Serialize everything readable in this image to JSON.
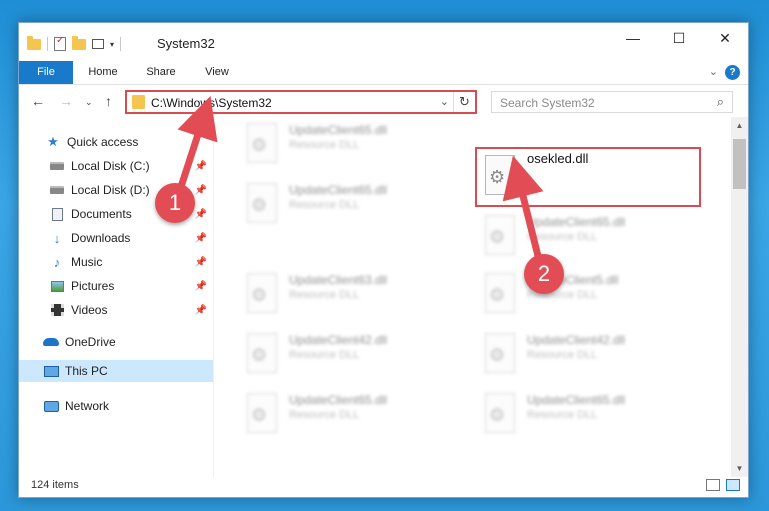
{
  "window": {
    "title": "System32",
    "controls": {
      "minimize": "—",
      "maximize": "☐",
      "close": "✕"
    }
  },
  "ribbon": {
    "tabs": [
      "File",
      "Home",
      "Share",
      "View"
    ],
    "expand": "⌄",
    "help": "?"
  },
  "navigation": {
    "back": "←",
    "forward": "→",
    "recent": "⌄",
    "up": "↑",
    "address": "C:\\Windows\\System32",
    "address_dropdown": "⌄",
    "refresh": "↻",
    "search_placeholder": "Search System32",
    "search_icon": "⌕"
  },
  "sidebar": {
    "items": [
      {
        "label": "Quick access",
        "icon": "star-icon"
      },
      {
        "label": "Local Disk (C:)",
        "icon": "drive-icon",
        "pinned": true
      },
      {
        "label": "Local Disk (D:)",
        "icon": "drive-icon",
        "pinned": true
      },
      {
        "label": "Documents",
        "icon": "document-icon",
        "pinned": true
      },
      {
        "label": "Downloads",
        "icon": "download-icon",
        "pinned": true
      },
      {
        "label": "Music",
        "icon": "music-icon",
        "pinned": true
      },
      {
        "label": "Pictures",
        "icon": "picture-icon",
        "pinned": true
      },
      {
        "label": "Videos",
        "icon": "video-icon",
        "pinned": true
      },
      {
        "label": "OneDrive",
        "icon": "cloud-icon"
      },
      {
        "label": "This PC",
        "icon": "computer-icon",
        "selected": true
      },
      {
        "label": "Network",
        "icon": "network-icon"
      }
    ],
    "pin_glyph": "📌"
  },
  "files": {
    "selected": {
      "name": "osekled.dll"
    },
    "items": [
      {
        "name": "UpdateClient65.dll",
        "type": "Resource DLL"
      },
      {
        "name": "UpdateClient65.dll",
        "type": "Resource DLL"
      },
      {
        "name": "UpdateClient65.dll",
        "type": "Resource DLL"
      },
      {
        "name": "UpdateClient63.dll",
        "type": "Resource DLL"
      },
      {
        "name": "UpdateClient5.dll",
        "type": "Resource DLL"
      },
      {
        "name": "UpdateClient42.dll",
        "type": "Resource DLL"
      },
      {
        "name": "UpdateClient42.dll",
        "type": "Resource DLL"
      },
      {
        "name": "UpdateClient65.dll",
        "type": "Resource DLL"
      },
      {
        "name": "UpdateClient65.dll",
        "type": "Resource DLL"
      }
    ],
    "gear_glyph": "⚙"
  },
  "statusbar": {
    "count": "124 items"
  },
  "scrollbar": {
    "up": "▲",
    "down": "▼"
  },
  "annotations": {
    "step1": "1",
    "step2": "2",
    "color": "#e24d55"
  }
}
